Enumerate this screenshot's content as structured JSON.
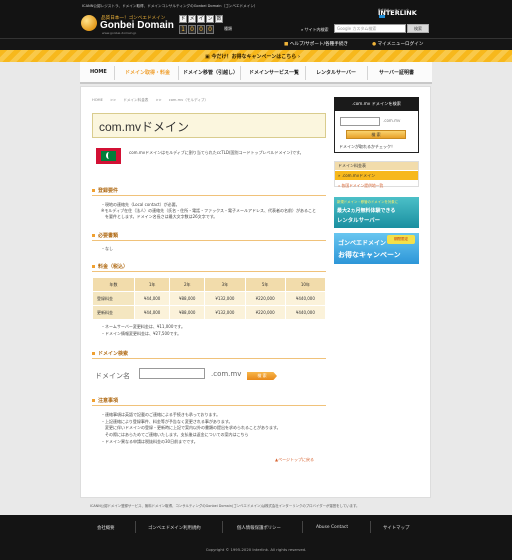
{
  "header": {
    "tagline": "ICANN公認レジストラ、ドメイン取得、ドメインコンサルティングのGonbei Domain（ゴンベエドメイン）",
    "logo_sub": "品質日本一！ゴンベエドメイン",
    "logo_main": "Gonbei Domain",
    "logo_url": "www.gonbei-domain.jp",
    "counter_caption_chars": [
      "ド",
      "メ",
      "イ",
      "ン",
      "数"
    ],
    "counter_digits": [
      "1",
      "0",
      "0",
      "0"
    ],
    "counter_suffix": "種類",
    "company_sub": "株式会社インターリンク",
    "company": "INTERLINK",
    "search_label": "サイト内検索",
    "search_placeholder": "Google カスタム検索",
    "search_button": "検索"
  },
  "subbar": {
    "help": "ヘルプ/サポート/各種手続き",
    "login": "マイメニューログイン"
  },
  "campaign": {
    "text": "今だけ！お得なキャンペーンはこちら"
  },
  "nav": {
    "items": [
      {
        "label": "HOME"
      },
      {
        "label": "ドメイン取得・料金"
      },
      {
        "label": "ドメイン移管（引越し）"
      },
      {
        "label": "ドメインサービス一覧"
      },
      {
        "label": "レンタルサーバー"
      },
      {
        "label": "サーバー証明書"
      }
    ]
  },
  "breadcrumb": {
    "home": "HOME",
    "sep": ">>",
    "parent": "ドメイン料金表",
    "current": "com.mv（モルディブ）"
  },
  "page": {
    "title": "com.mvドメイン",
    "intro": "com.mvドメインはモルディブに割り当てられたccTLD(国別コードトップレベルドメイン)です。"
  },
  "registration": {
    "heading": "登録要件",
    "notes": [
      "・現地の連絡先（Local contact）が必要。",
      "※モルディブ在住（法人）の連絡先（氏名・住所・電話・ファックス・電子メールアドレス、代表者の名前）があること",
      "　を要件とします。ドメイン名長さは最大文字数は26文字です。"
    ]
  },
  "documents": {
    "heading": "必要書類",
    "note": "・なし"
  },
  "pricing": {
    "heading": "料金（税込）",
    "columns": [
      "年数",
      "1年",
      "2年",
      "3年",
      "5年",
      "10年"
    ],
    "rows": [
      {
        "label": "登録料金",
        "values": [
          "¥44,000",
          "¥88,000",
          "¥132,000",
          "¥220,000",
          "¥440,000"
        ]
      },
      {
        "label": "更新料金",
        "values": [
          "¥44,000",
          "¥88,000",
          "¥132,000",
          "¥220,000",
          "¥440,000"
        ]
      }
    ],
    "notes": [
      "・ネームサーバー変更料金は、¥11,000です。",
      "・ドメイン情報変更料金は、¥27,500です。"
    ]
  },
  "domain_search": {
    "heading": "ドメイン検索",
    "label": "ドメイン名",
    "ext": ".com.mv",
    "button": "検 索"
  },
  "caution": {
    "heading": "注意事項",
    "notes": [
      "・連絡事項は英語で記載のご連絡による手続きも承っております。",
      "・上記連絡により登録事件、料金等が予告なく変更される事があります。",
      "　変更に伴いドメインの登録・更新時に上記で案内以外の書類の提出を求められることがあります。",
      "　その際にはあらためてご連絡いたします。支払後は返金についての案内はこちら",
      "・ドメイン異なる申請は税抜料金の30日前までです。"
    ],
    "back_to_top": "▲ページトップに戻る"
  },
  "sidebar": {
    "search_title": ".com.mv ドメインを検索",
    "search_ext": ".com.mv",
    "search_button": "検 索",
    "check_text": "ドメインが取れるかチェック！",
    "menu_title": "ドメイン料金表",
    "menu_current": "» .com.mvドメイン",
    "menu_link": "» 各国ドメイン提供地一覧",
    "banner1_top": "新規ドメイン・移管のドメインを対象に",
    "banner1_main": "最大2ヵ月無料体験できる",
    "banner1_sub": "レンタルサーバー",
    "banner2_badge": "期間限定",
    "banner2_main": "ゴンベエドメイン",
    "banner2_sub": "お得なキャンペーン"
  },
  "footer": {
    "note": "ICANN公認ドメイン登録サービス、無料ドメイン取得、コンサルティングのGonbei Domain(ゴンベエドメイン)は株式会社インターリンクのプロバイダーが運営をしています。",
    "links": [
      {
        "label": "会社概要"
      },
      {
        "label": "ゴンベエドメイン利用規約"
      },
      {
        "label": "個人情報保護ポリシー"
      },
      {
        "label": "Abuse Contact"
      },
      {
        "label": "サイトマップ"
      }
    ],
    "copyright": "Copyright © 1995-2020 Interlink. All rights reserved."
  },
  "colors": {
    "accent": "#f0a030",
    "campaign": "#f7b81c",
    "link": "#d7622f"
  }
}
